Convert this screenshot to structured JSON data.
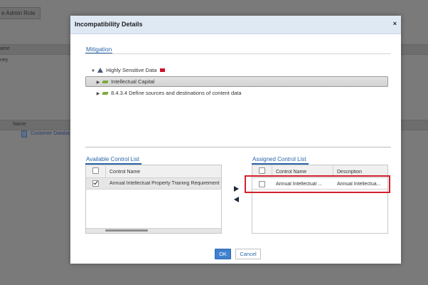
{
  "background": {
    "tab_label": "e Admin Role",
    "table1": {
      "header": "ame",
      "row1": "ney"
    },
    "table2": {
      "header": "Name",
      "row1_link": "Customer Databa"
    }
  },
  "modal": {
    "title": "Incompatibility Details",
    "close_glyph": "×",
    "mitigation_tab": "Mitigation",
    "tree": [
      {
        "label": "Highly Sensitive Data",
        "toggle": "▼"
      },
      {
        "label": "Intellectual Capital",
        "toggle": "▶"
      },
      {
        "label": "8.4.3.4 Define sources and destinations of content data",
        "toggle": "▶"
      }
    ],
    "available": {
      "title": "Available Control List",
      "column": "Control Name",
      "rows": [
        {
          "name": "Annual Intellectual Property Training Requirement",
          "checked": true
        }
      ]
    },
    "assigned": {
      "title": "Assigned Control List",
      "columns": [
        "Control Name",
        "Description"
      ],
      "rows": [
        {
          "name": "Annual Intellectual ...",
          "description": "Annual Intellectua..."
        }
      ]
    },
    "ok_label": "OK",
    "cancel_label": "Cancel"
  },
  "colors": {
    "accent": "#2b66a8",
    "ok_button": "#3f80cf",
    "highlight": "#d3202a",
    "flag": "#d0102a",
    "header_bg": "#dfe9f4"
  },
  "icons": {
    "tree_root": "warning-triangle-icon",
    "tree_root_badge": "red-flag-icon",
    "tree_child": "folder-icon",
    "move_right": "arrow-right-icon",
    "move_left": "arrow-left-icon"
  }
}
